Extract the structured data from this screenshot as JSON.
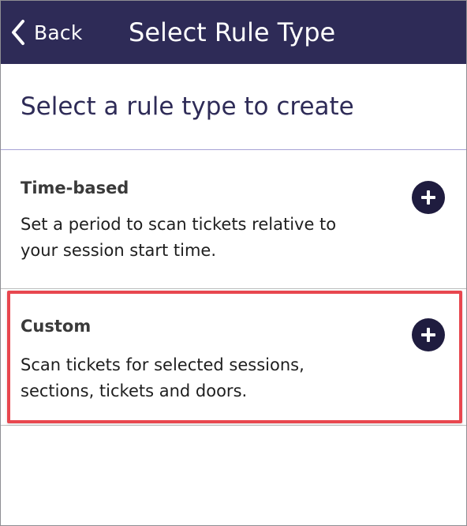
{
  "navbar": {
    "back_label": "Back",
    "title": "Select Rule Type",
    "background_color": "#2e2b57",
    "back_icon": "chevron-left-icon"
  },
  "main": {
    "heading": "Select a rule type to create",
    "rule_types": [
      {
        "title": "Time-based",
        "description": "Set a period to scan tickets relative to your session start time.",
        "action_icon": "plus-circle-icon"
      },
      {
        "title": "Custom",
        "description": "Scan tickets for selected sessions, sections, tickets and doors.",
        "action_icon": "plus-circle-icon",
        "highlighted": true
      }
    ]
  },
  "colors": {
    "accent": "#2e2b57",
    "button": "#1f1c3f",
    "highlight": "#e8474f",
    "divider": "#a7a3d6"
  }
}
